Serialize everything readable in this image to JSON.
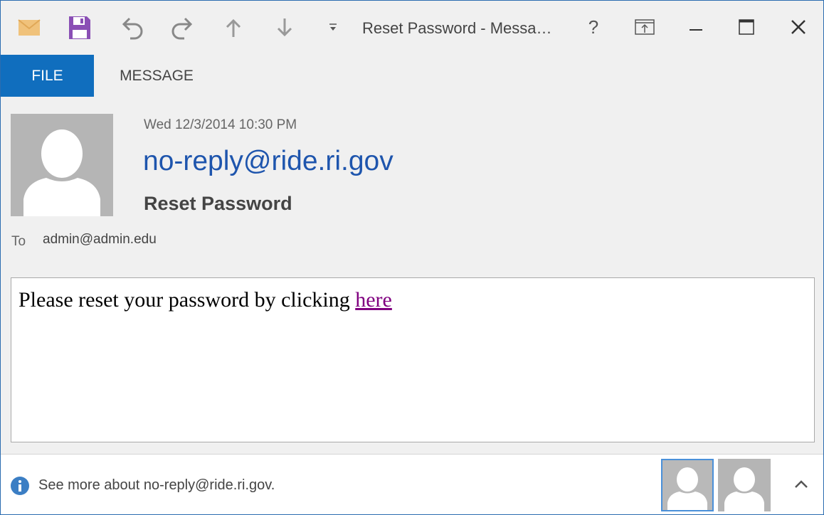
{
  "window": {
    "title": "Reset Password - Messa…"
  },
  "toolbar": {
    "icons": [
      "envelope-icon",
      "save-icon",
      "undo-icon",
      "redo-icon",
      "previous-item-icon",
      "next-item-icon",
      "customize-toolbar-icon"
    ]
  },
  "window_controls": {
    "help": "?"
  },
  "ribbon": {
    "tabs": [
      {
        "label": "FILE",
        "active": true
      },
      {
        "label": "MESSAGE",
        "active": false
      }
    ]
  },
  "header": {
    "date": "Wed 12/3/2014 10:30 PM",
    "sender": "no-reply@ride.ri.gov",
    "subject": "Reset Password",
    "to_label": "To",
    "to_value": "admin@admin.edu"
  },
  "body": {
    "text": "Please reset your password by clicking",
    "link_text": "here"
  },
  "footer": {
    "info_text": "See more about no-reply@ride.ri.gov."
  },
  "colors": {
    "accent": "#106ebe",
    "sender": "#1e55ad",
    "link_visited": "#800080",
    "save_icon": "#8a4fb5",
    "envelope_icon": "#f0c27b"
  }
}
